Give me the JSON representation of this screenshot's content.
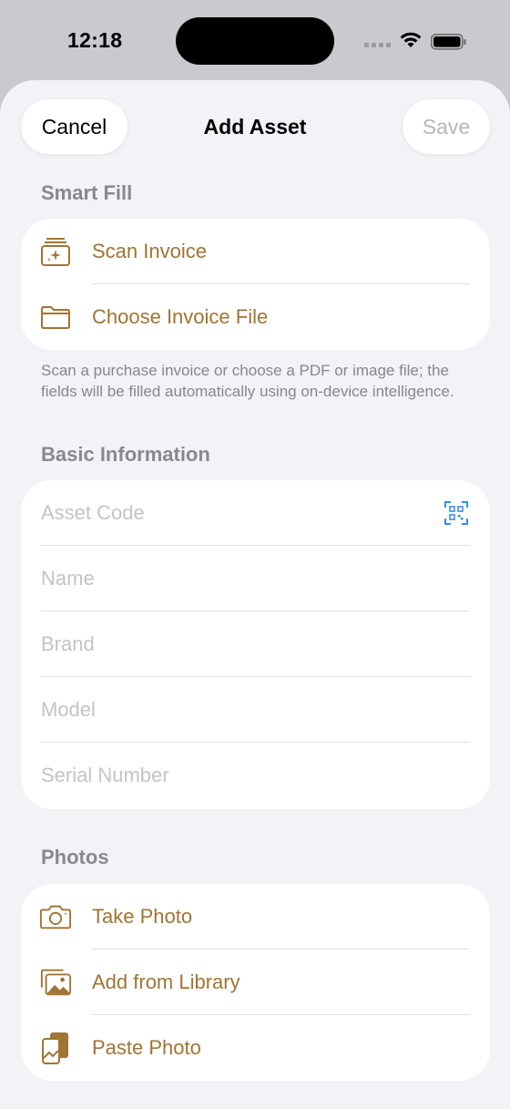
{
  "status_bar": {
    "time": "12:18"
  },
  "nav": {
    "cancel_label": "Cancel",
    "title": "Add Asset",
    "save_label": "Save"
  },
  "smart_fill": {
    "header": "Smart Fill",
    "items": [
      {
        "label": "Scan Invoice",
        "icon": "scan-invoice-icon"
      },
      {
        "label": "Choose Invoice File",
        "icon": "folder-icon"
      }
    ],
    "footnote": "Scan a purchase invoice or choose a PDF or image file; the fields will be filled automatically using on-device intelligence."
  },
  "basic_info": {
    "header": "Basic Information",
    "fields": [
      {
        "placeholder": "Asset Code"
      },
      {
        "placeholder": "Name"
      },
      {
        "placeholder": "Brand"
      },
      {
        "placeholder": "Model"
      },
      {
        "placeholder": "Serial Number"
      }
    ]
  },
  "photos": {
    "header": "Photos",
    "items": [
      {
        "label": "Take Photo",
        "icon": "camera-icon"
      },
      {
        "label": "Add from Library",
        "icon": "photo-library-icon"
      },
      {
        "label": "Paste Photo",
        "icon": "paste-photo-icon"
      }
    ]
  },
  "colors": {
    "accent": "#a07434",
    "qr_accent": "#3a8de0",
    "background": "#f2f2f7",
    "placeholder": "#c4c4c8"
  }
}
